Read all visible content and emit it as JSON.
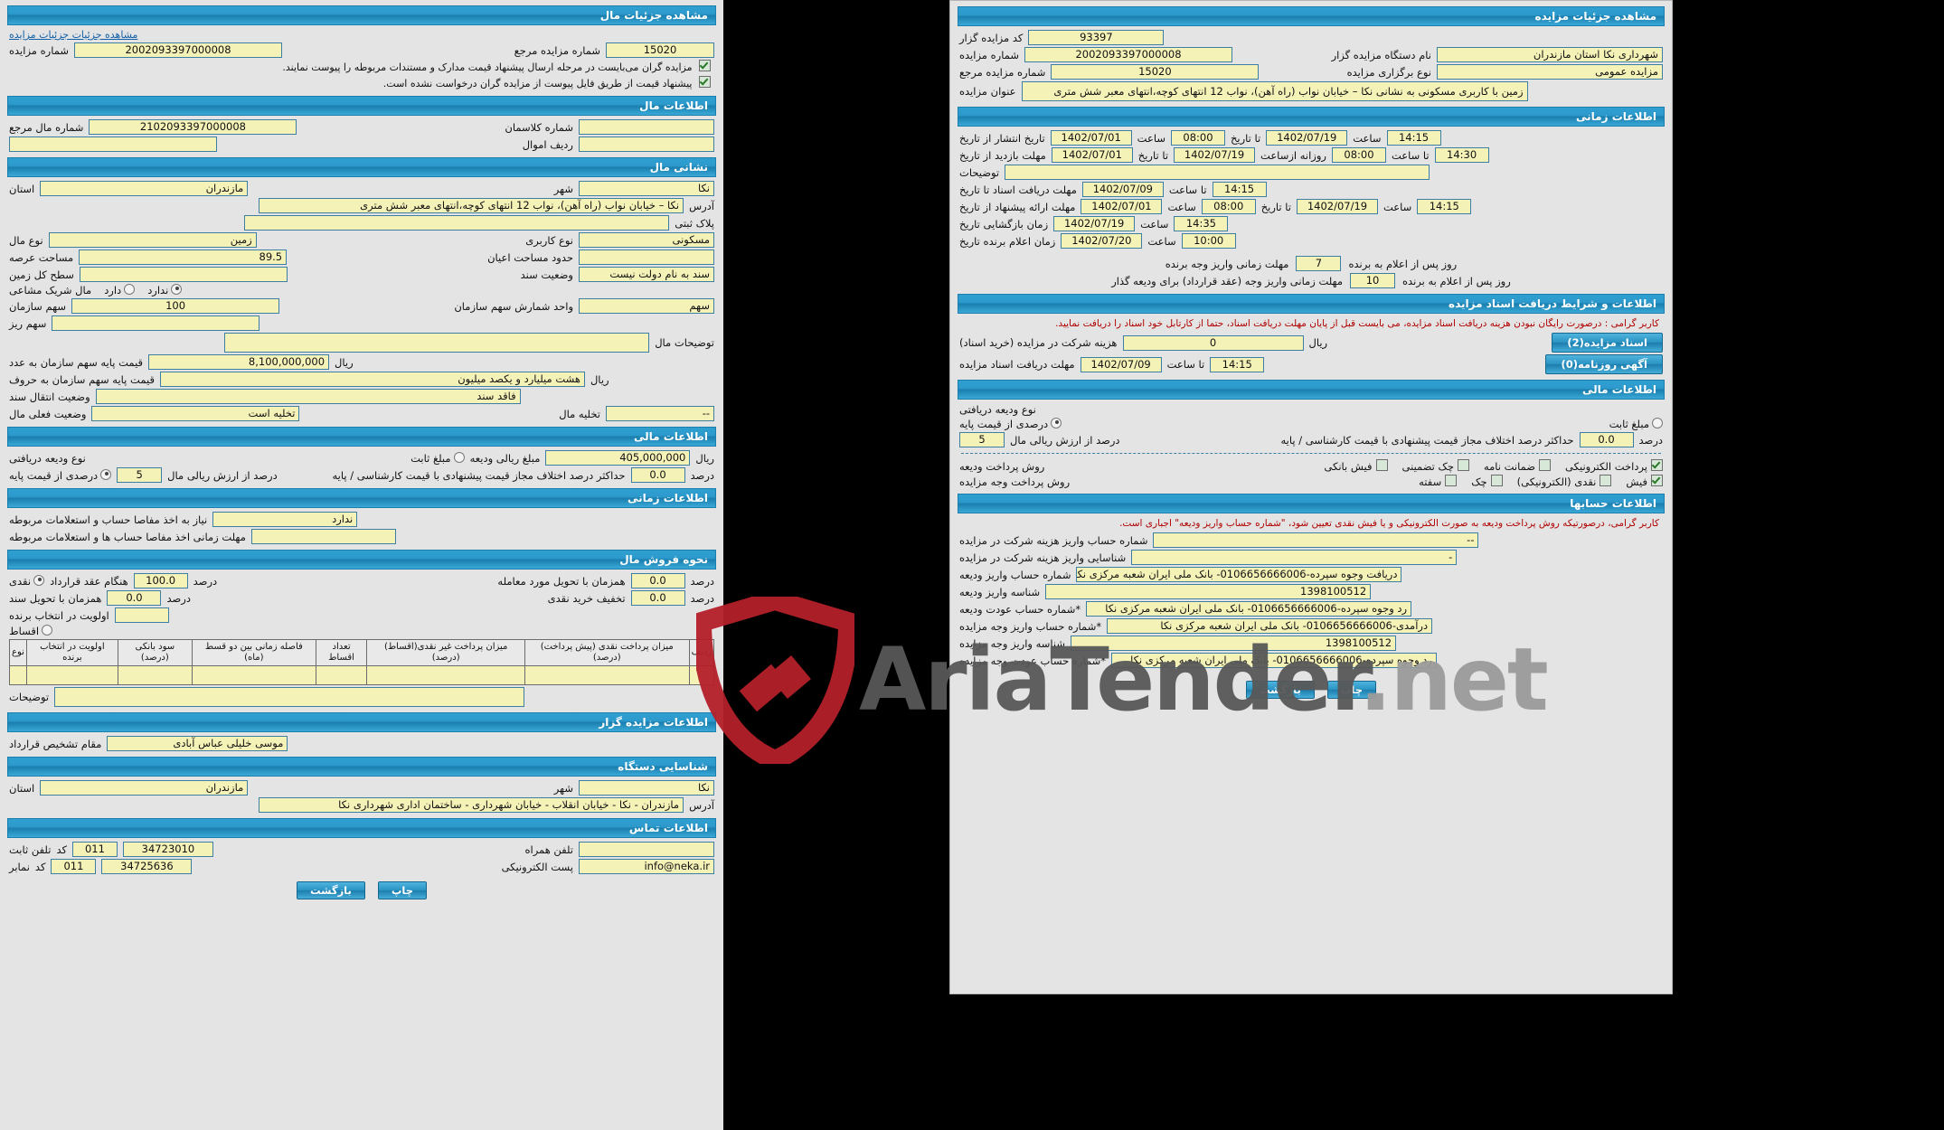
{
  "watermark": {
    "text": "AriaTender",
    "suffix": ".net"
  },
  "left": {
    "header": "مشاهده جزئیات مال",
    "view_link": "مشاهده جزئیات جزئیات مزایده",
    "auction_number_label": "شماره مزایده",
    "auction_number": "2002093397000008",
    "ref_number_label": "شماره مزایده مرجع",
    "ref_number": "15020",
    "note1": "مزایده گران می‌بایست در مرحله ارسال پیشنهاد قیمت مدارک و مستندات مربوطه را پیوست نمایند.",
    "note2": "پیشنهاد قیمت از طریق فایل پیوست از مزایده گران درخواست نشده است.",
    "property_info_header": "اطلاعات مال",
    "property_number_label": "شماره مال مرجع",
    "property_number": "2102093397000008",
    "classman_label": "شماره کلاسمان",
    "classman": "",
    "assets_row_label": "ردیف اموال",
    "assets_row": "",
    "address_header": "نشانی مال",
    "province_label": "استان",
    "province": "مازندران",
    "city_label": "شهر",
    "city": "نکا",
    "address_label": "آدرس",
    "address": "نکا – خیابان نواب (راه آهن)، نواب 12 انتهای کوچه،انتهای معبر شش متری",
    "postal_label": "پلاک ثبتی",
    "postal": "",
    "asset_type_label": "نوع مال",
    "asset_type": "زمین",
    "usage_type_label": "نوع کاربری",
    "usage_type": "مسکونی",
    "area_label": "مساحت عرصه",
    "area": "89.5",
    "building_area_label": "حدود مساحت اعیان",
    "building_area": "",
    "land_total_label": "سطح کل زمین",
    "land_total": "",
    "doc_status_label": "وضعیت سند",
    "doc_status": "سند به نام دولت نیست",
    "partnership_label": "مال شریک مشاعی",
    "partnership_has": "دارد",
    "partnership_not": "ندارد",
    "org_share_label": "سهم سازمان",
    "org_share": "100",
    "share_unit_label": "واحد شمارش سهم سازمان",
    "share_unit": "سهم",
    "micro_share_label": "سهم ریز",
    "micro_share": "",
    "description_label": "توضیحات مال",
    "description": "",
    "base_price_label": "قیمت پایه سهم سازمان به عدد",
    "base_price": "8,100,000,000",
    "rial": "ریال",
    "base_price_words_label": "قیمت پایه سهم سازمان به حروف",
    "base_price_words": "هشت میلیارد و یکصد میلیون",
    "transfer_status_label": "وضعیت انتقال سند",
    "transfer_status": "فاقد سند",
    "current_status_label": "وضعیت فعلی مال",
    "current_status": "تخلیه است",
    "vacate_label": "تخلیه مال",
    "vacate": "--",
    "financial_header": "اطلاعات مالی",
    "deposit_type_label": "نوع ودیعه دریافتی",
    "fixed_amount": "مبلغ ثابت",
    "percent_of_base": "درصدی از قیمت پایه",
    "deposit_rial_label": "مبلغ ریالی ودیعه",
    "deposit_rial": "405,000,000",
    "percent_value_label": "درصد از ارزش ریالی مال",
    "percent_value": "5",
    "max_diff_label": "حداکثر درصد اختلاف مجاز قیمت پیشنهادی با قیمت کارشناسی / پایه",
    "max_diff": "0.0",
    "percent": "درصد",
    "time_header": "اطلاعات زمانی",
    "need_clearance_label": "نیاز به اخذ مفاصا حساب و استعلامات مربوطه",
    "need_clearance": "ندارد",
    "clearance_time_label": "مهلت زمانی اخذ مفاصا حساب ها و استعلامات مربوطه",
    "clearance_time": "",
    "sale_method_header": "نحوه فروش مال",
    "cash_label": "نقدی",
    "at_contract_label": "هنگام عقد قرارداد",
    "at_contract": "100.0",
    "with_delivery_label": "همزمان با تحویل مورد معامله",
    "with_delivery": "0.0",
    "with_doc_label": "همزمان با تحویل سند",
    "with_doc": "0.0",
    "cash_discount_label": "تخفیف خرید نقدی",
    "cash_discount": "0.0",
    "priority_label": "اولویت در انتخاب برنده",
    "priority": "",
    "installment_label": "اقساط",
    "table_headers": [
      "ردیف",
      "میزان پرداخت نقدی (پیش پرداخت)(درصد)",
      "میزان پرداخت غیر نقدی(اقساط) (درصد)",
      "تعداد اقساط",
      "فاصله زمانی بین دو قسط (ماه)",
      "سود بانکی (درصد)",
      "اولویت در انتخاب برنده",
      "نوع"
    ],
    "desc2_label": "توضیحات",
    "desc2": "",
    "organizer_header": "اطلاعات مزایده گزار",
    "contract_signer_label": "مقام تشخیص قرارداد",
    "contract_signer": "موسی خلیلی عباس آبادی",
    "device_header": "شناسایی دستگاه",
    "org_province_label": "استان",
    "org_province": "مازندران",
    "org_city_label": "شهر",
    "org_city": "نکا",
    "org_address_label": "آدرس",
    "org_address": "مازندران - نکا - خیابان انقلاب - خیابان شهرداری - ساختمان اداری شهرداری نکا",
    "contact_header": "اطلاعات تماس",
    "tel_label": "تلفن ثابت",
    "tel_code": "011",
    "tel": "34723010",
    "code_label": "کد",
    "mobile_label": "تلفن همراه",
    "mobile": "",
    "fax_label": "نمابر",
    "fax_code": "011",
    "fax": "34725636",
    "email_label": "پست الکترونیکی",
    "email": "info@neka.ir",
    "print_btn": "چاپ",
    "back_btn": "بازگشت"
  },
  "right": {
    "header": "مشاهده جزئیات مزایده",
    "auctioneer_code_label": "کد مزایده گزار",
    "auctioneer_code": "93397",
    "auction_number_label": "شماره مزایده",
    "auction_number": "2002093397000008",
    "ref_number_label": "شماره مزایده مرجع",
    "ref_number": "15020",
    "auctioneer_name_label": "نام دستگاه مزایده گزار",
    "auctioneer_name": "شهرداری نکا استان مازندران",
    "auction_type_label": "نوع برگزاری مزایده",
    "auction_type": "مزایده عمومی",
    "title_label": "عنوان مزایده",
    "title": "زمین با کاربری مسکونی به نشانی نکا – خیابان نواب (راه آهن)، نواب 12 انتهای کوچه،انتهای معبر شش متری",
    "time_header": "اطلاعات زمانی",
    "publish_label": "تاریخ انتشار  از تاریخ",
    "publish_from_date": "1402/07/01",
    "publish_from_time": "08:00",
    "hour": "ساعت",
    "publish_to": "تا تاریخ",
    "publish_to_date": "1402/07/19",
    "publish_to_time": "14:15",
    "visit_label": "مهلت بازدید  از تاریخ",
    "visit_from_date": "1402/07/01",
    "visit_from_time": "08:00",
    "visit_daily": "روزانه ازساعت",
    "visit_to_date": "1402/07/19",
    "visit_to_time_label": "تا ساعت",
    "visit_to_time": "14:30",
    "desc_label": "توضیحات",
    "desc": "",
    "doc_deadline_label": "مهلت دریافت اسناد  تا تاریخ",
    "doc_deadline_date": "1402/07/09",
    "doc_deadline_to": "تا ساعت",
    "doc_deadline_time": "14:15",
    "offer_label": "مهلت ارائه پیشنهاد  از تاریخ",
    "offer_from_date": "1402/07/01",
    "offer_from_time": "08:00",
    "offer_to": "تا تاریخ",
    "offer_to_date": "1402/07/19",
    "offer_to_time": "14:15",
    "open_label": "زمان بازگشایی  تاریخ",
    "open_date": "1402/07/19",
    "open_time": "14:35",
    "winner_label": "زمان اعلام برنده  تاریخ",
    "winner_date": "1402/07/20",
    "winner_time": "10:00",
    "deposit_days_label": "مهلت زمانی واریز وجه برنده",
    "deposit_days": "7",
    "deposit_days_suffix": "روز پس از اعلام به برنده",
    "guarantee_days_label": "مهلت زمانی واریز وجه (عقد قرارداد) برای ودیعه گذار",
    "guarantee_days": "10",
    "guarantee_days_suffix": "روز پس از اعلام به برنده",
    "docs_header": "اطلاعات و شرایط دریافت اسناد مزایده",
    "docs_warning": "کاربر گرامی : درصورت رایگان نبودن هزینه دریافت اسناد مزایده، می بایست قبل از پایان مهلت دریافت اسناد، حتما از کارتابل خود اسناد را دریافت نمایید.",
    "fee_label": "هزینه شرکت در مزایده (خرید اسناد)",
    "fee": "0",
    "rial": "ریال",
    "doc_get_label": "مهلت دریافت اسناد مزایده",
    "doc_get_date": "1402/07/09",
    "doc_get_to": "تا ساعت",
    "doc_get_time": "14:15",
    "docs_btn": "اسناد مزایده(2)",
    "ads_btn": "آگهی روزنامه(0)",
    "financial_header": "اطلاعات مالی",
    "deposit_type_label": "نوع ودیعه دریافتی",
    "percent_of_base": "درصدی از قیمت پایه",
    "fixed_amount": "مبلغ ثابت",
    "percent_value": "5",
    "percent_value_label": "درصد از ارزش ریالی مال",
    "max_diff_label": "حداکثر درصد اختلاف مجاز قیمت پیشنهادی با قیمت کارشناسی / پایه",
    "max_diff": "0.0",
    "percent": "درصد",
    "deposit_method_label": "روش پرداخت ودیعه",
    "deposit_methods": [
      "پرداخت الکترونیکی",
      "ضمانت نامه",
      "چک تضمینی",
      "فیش بانکی"
    ],
    "payment_method_label": "روش پرداخت وجه مزایده",
    "payment_methods": [
      "فیش",
      "نقدی (الکترونیکی)",
      "چک",
      "سفته"
    ],
    "accounts_header": "اطلاعات حسابها",
    "accounts_note": "کاربر گرامی، درصورتیکه روش پرداخت ودیعه به صورت الکترونیکی و یا فیش نقدی تعیین شود، \"شماره حساب واریز ودیعه\" اجباری است.",
    "rows": [
      {
        "label": "شماره حساب واریز هزینه شرکت در مزایده",
        "value": "--"
      },
      {
        "label": "شناسایی واریز هزینه شرکت در مزایده",
        "value": "-"
      },
      {
        "label": "شماره حساب واریز ودیعه",
        "value": "دریافت وجوه سپرده-0106656666006- بانک ملی ایران شعبه مرکزی نکا"
      },
      {
        "label": "شناسه واریز ودیعه",
        "value": "1398100512"
      },
      {
        "label": "*شماره حساب عودت ودیعه",
        "value": "رد وجوه سپرده-0106656666006- بانک ملی ایران شعبه مرکزی نکا"
      },
      {
        "label": "*شماره حساب واریز وجه مزایده",
        "value": "درآمدی-0106656666006- بانک ملی ایران شعبه مرکزی نکا"
      },
      {
        "label": "شناسه واریز وجه مزایده",
        "value": "1398100512"
      },
      {
        "label": "*شماره حساب عودت وجه مزایده",
        "value": "رد وجوه سپرده-0106656666006- بانک ملی ایران شعبه مرکزی نکا"
      }
    ],
    "print_btn": "چاپ",
    "back_btn": "بازگشت"
  }
}
